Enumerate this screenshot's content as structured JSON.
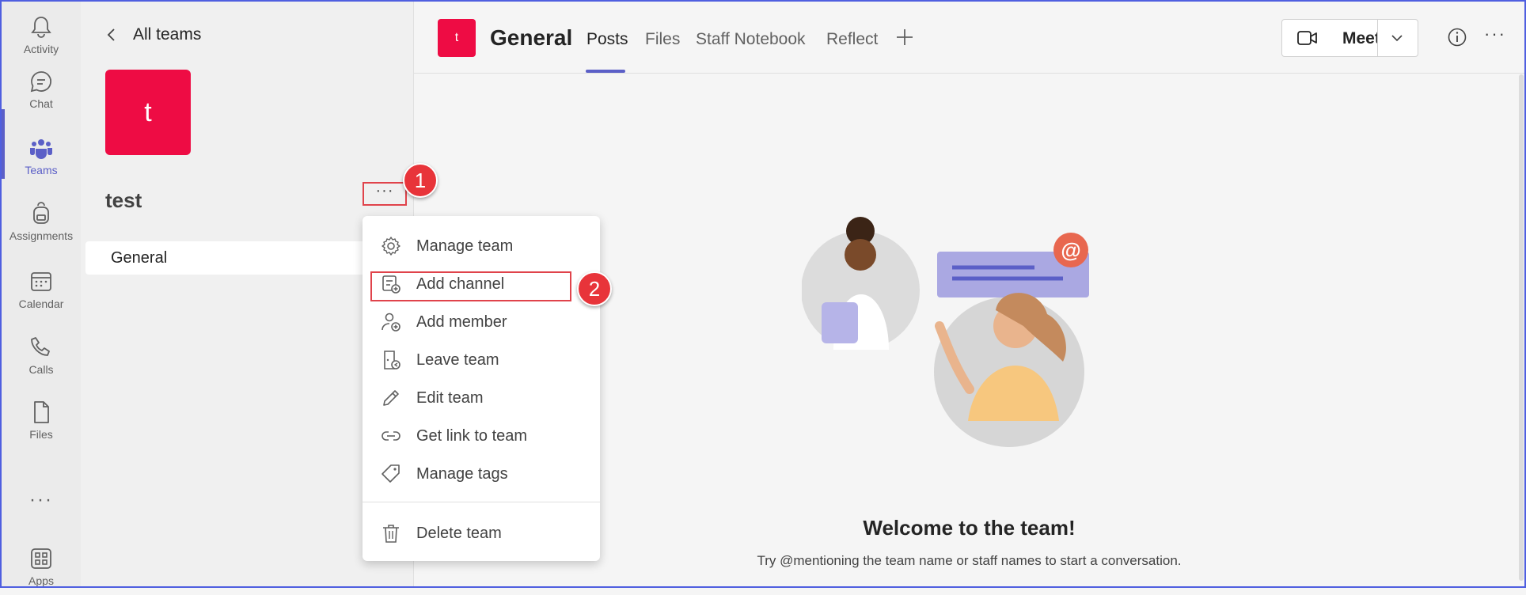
{
  "rail": {
    "items": [
      {
        "label": "Activity",
        "icon": "bell-icon"
      },
      {
        "label": "Chat",
        "icon": "chat-icon"
      },
      {
        "label": "Teams",
        "icon": "teams-icon",
        "active": true
      },
      {
        "label": "Assignments",
        "icon": "backpack-icon"
      },
      {
        "label": "Calendar",
        "icon": "calendar-icon"
      },
      {
        "label": "Calls",
        "icon": "phone-icon"
      },
      {
        "label": "Files",
        "icon": "file-icon"
      }
    ],
    "more": "···",
    "apps": {
      "label": "Apps",
      "icon": "apps-icon"
    }
  },
  "panel": {
    "back_label": "All teams",
    "team_avatar_letter": "t",
    "team_name": "test",
    "team_more": "···",
    "channels": [
      {
        "label": "General"
      }
    ]
  },
  "callouts": {
    "one": "1",
    "two": "2"
  },
  "menu": {
    "items": [
      {
        "label": "Manage team",
        "icon": "gear-icon"
      },
      {
        "label": "Add channel",
        "icon": "add-channel-icon"
      },
      {
        "label": "Add member",
        "icon": "add-person-icon"
      },
      {
        "label": "Leave team",
        "icon": "leave-icon"
      },
      {
        "label": "Edit team",
        "icon": "pencil-icon"
      },
      {
        "label": "Get link to team",
        "icon": "link-icon"
      },
      {
        "label": "Manage tags",
        "icon": "tag-icon"
      }
    ],
    "delete": {
      "label": "Delete team",
      "icon": "trash-icon"
    }
  },
  "header": {
    "channel_avatar_letter": "t",
    "title": "General",
    "tabs": [
      {
        "label": "Posts",
        "active": true
      },
      {
        "label": "Files"
      },
      {
        "label": "Staff Notebook"
      },
      {
        "label": "Reflect"
      }
    ],
    "meet_label": "Meet",
    "more": "···"
  },
  "main": {
    "welcome_title": "Welcome to the team!",
    "welcome_subtitle": "Try @mentioning the team name or staff names to start a conversation."
  },
  "colors": {
    "brand": "#5b5fc7",
    "team_avatar": "#ee0c44",
    "callout": "#e8343a",
    "frame": "#4f5fe0"
  }
}
